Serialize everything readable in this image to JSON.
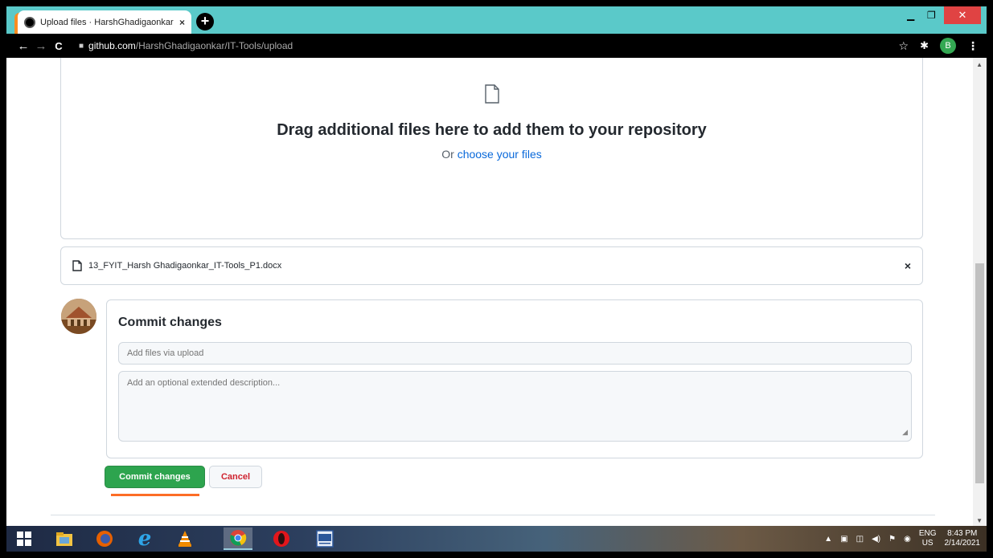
{
  "browser": {
    "tab_title": "Upload files · HarshGhadigaonkar",
    "tab_close": "×",
    "new_tab": "+",
    "url_host": "github.com",
    "url_path": "/HarshGhadigaonkar/IT-Tools/upload",
    "profile_initial": "B",
    "icons": {
      "back": "arrow-left-icon",
      "forward": "arrow-right-icon",
      "reload": "reload-icon",
      "lock": "lock-icon",
      "star": "star-icon",
      "extensions": "puzzle-icon",
      "menu": "kebab-menu-icon"
    }
  },
  "dropzone": {
    "title": "Drag additional files here to add them to your repository",
    "sub_prefix": "Or ",
    "sub_link": "choose your files"
  },
  "file": {
    "name": "13_FYIT_Harsh Ghadigaonkar_IT-Tools_P1.docx",
    "remove": "×"
  },
  "commit": {
    "title": "Commit changes",
    "summary_placeholder": "Add files via upload",
    "description_placeholder": "Add an optional extended description...",
    "commit_button": "Commit changes",
    "cancel_button": "Cancel"
  },
  "taskbar": {
    "lang_top": "ENG",
    "lang_bottom": "US",
    "time": "8:43 PM",
    "date": "2/14/2021"
  },
  "colors": {
    "titlebar": "#5ac9c9",
    "commit_green": "#2da44e",
    "link_blue": "#0969da",
    "cancel_red": "#cf222e",
    "close_red": "#e04343"
  }
}
